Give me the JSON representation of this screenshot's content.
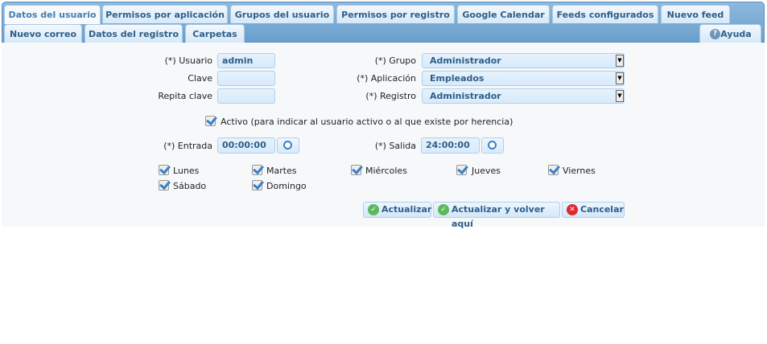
{
  "tabs_row1": [
    "Datos del usuario",
    "Permisos por aplicación",
    "Grupos del usuario",
    "Permisos por registro",
    "Google Calendar",
    "Feeds configurados",
    "Nuevo feed"
  ],
  "tabs_row2": [
    "Nuevo correo",
    "Datos del registro",
    "Carpetas"
  ],
  "help_label": "Ayuda",
  "form": {
    "usuario_label": "(*) Usuario",
    "usuario_value": "admin",
    "clave_label": "Clave",
    "clave_value": "",
    "repita_label": "Repita clave",
    "repita_value": "",
    "grupo_label": "(*) Grupo",
    "grupo_value": "Administrador",
    "aplicacion_label": "(*) Aplicación",
    "aplicacion_value": "Empleados",
    "registro_label": "(*) Registro",
    "registro_value": "Administrador",
    "activo_label": "Activo (para indicar al usuario activo o al que existe por herencia)",
    "entrada_label": "(*) Entrada",
    "entrada_value": "00:00:00",
    "salida_label": "(*) Salida",
    "salida_value": "24:00:00",
    "days": [
      "Lunes",
      "Martes",
      "Miércoles",
      "Jueves",
      "Viernes",
      "Sábado",
      "Domingo"
    ]
  },
  "buttons": {
    "update": "Actualizar",
    "update_return": "Actualizar y volver aquí",
    "cancel": "Cancelar"
  }
}
